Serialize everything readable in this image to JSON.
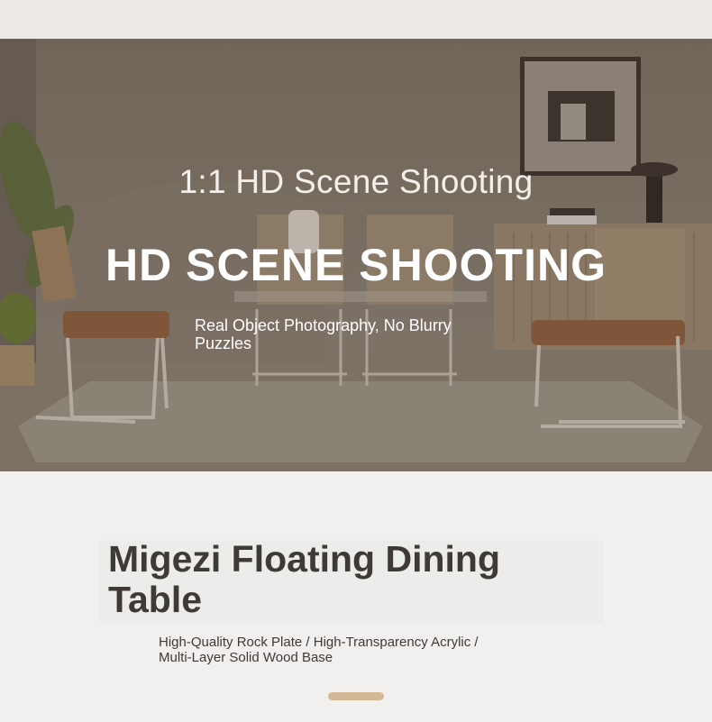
{
  "hero": {
    "subtitle": "1:1 HD Scene Shooting",
    "title": "HD SCENE SHOOTING",
    "caption": "Real Object Photography, No Blurry Puzzles"
  },
  "product": {
    "title": "Migezi Floating Dining Table",
    "features": "High-Quality Rock Plate / High-Transparency Acrylic / Multi-Layer Solid Wood Base"
  },
  "colors": {
    "accent": "#d3b895",
    "text_dark": "#3f3a37",
    "background": "#f1f0ef"
  }
}
